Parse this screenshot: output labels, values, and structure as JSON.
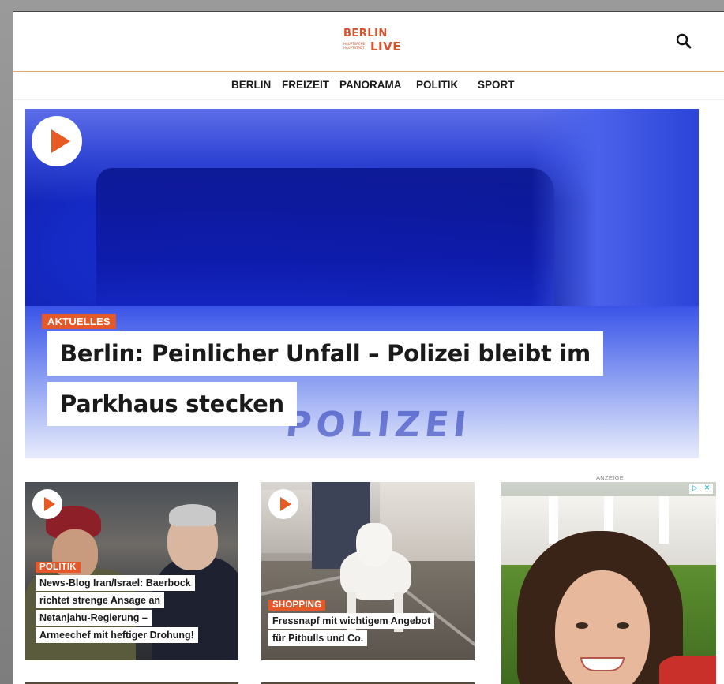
{
  "header": {
    "logo_top": "BERLIN",
    "logo_bottom": "LIVE",
    "logo_small": "HAUPTSACHE HAUPTSTADT",
    "search_icon": "search-icon"
  },
  "nav": {
    "items": [
      "BERLIN",
      "FREIZEIT",
      "PANORAMA",
      "POLITIK",
      "SPORT"
    ]
  },
  "hero": {
    "tag": "AKTUELLES",
    "headline_line1": "Berlin: Peinlicher Unfall – Polizei bleibt im",
    "headline_line2": "Parkhaus stecken",
    "image_text": "POLIZEI",
    "play_icon": "play-icon"
  },
  "cards": [
    {
      "tag": "POLITIK",
      "lines": [
        "News-Blog Iran/Israel: Baerbock",
        "richtet strenge Ansage an",
        "Netanjahu-Regierung –",
        "Armeechef mit heftiger Drohung!"
      ]
    },
    {
      "tag": "SHOPPING",
      "lines": [
        "Fressnapf mit wichtigem Angebot",
        "für Pitbulls und Co."
      ]
    }
  ],
  "ad": {
    "label": "ANZEIGE",
    "icons": [
      "▷",
      "✕"
    ]
  },
  "colors": {
    "accent": "#e4582a",
    "logo": "#d9502b",
    "nav_text": "#1a1a1a"
  }
}
